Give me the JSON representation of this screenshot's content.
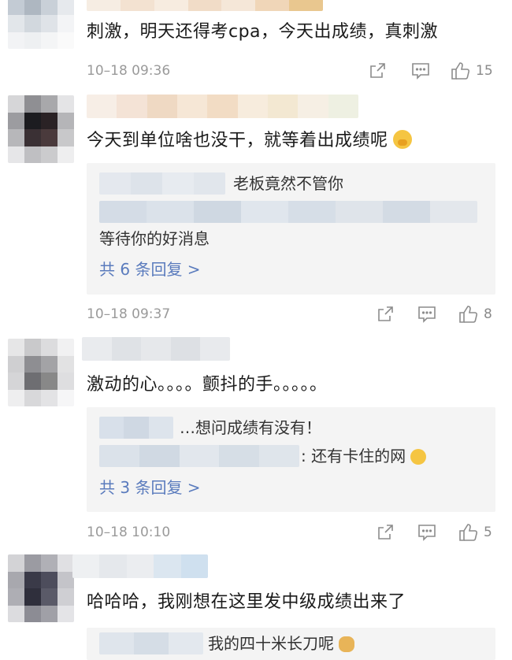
{
  "comments": [
    {
      "text": "刺激，明天还得考cpa，今天出成绩，真刺激",
      "time": "10–18 09:36",
      "likes": "15"
    },
    {
      "text": "今天到单位啥也没干，就等着出成绩呢",
      "time": "10–18 09:37",
      "likes": "8",
      "replies": [
        "老板竟然不管你",
        "等待你的好消息"
      ],
      "more": "共 6 条回复 >"
    },
    {
      "text": "激动的心。。。。颤抖的手。。。。。",
      "time": "10–18 10:10",
      "likes": "5",
      "replies": [
        "…想问成绩有没有！",
        ": 还有卡住的网"
      ],
      "more": "共 3 条回复 >"
    },
    {
      "text": "哈哈哈，我刚想在这里发中级成绩出来了",
      "replies": [
        "我的四十米长刀呢"
      ]
    }
  ],
  "icons": {
    "share": "share-icon",
    "comment": "comment-icon",
    "like": "thumbs-up-icon"
  },
  "colors": {
    "link": "#5a7bbd",
    "meta": "#9a9a9a",
    "reply_bg": "#f4f4f4"
  }
}
